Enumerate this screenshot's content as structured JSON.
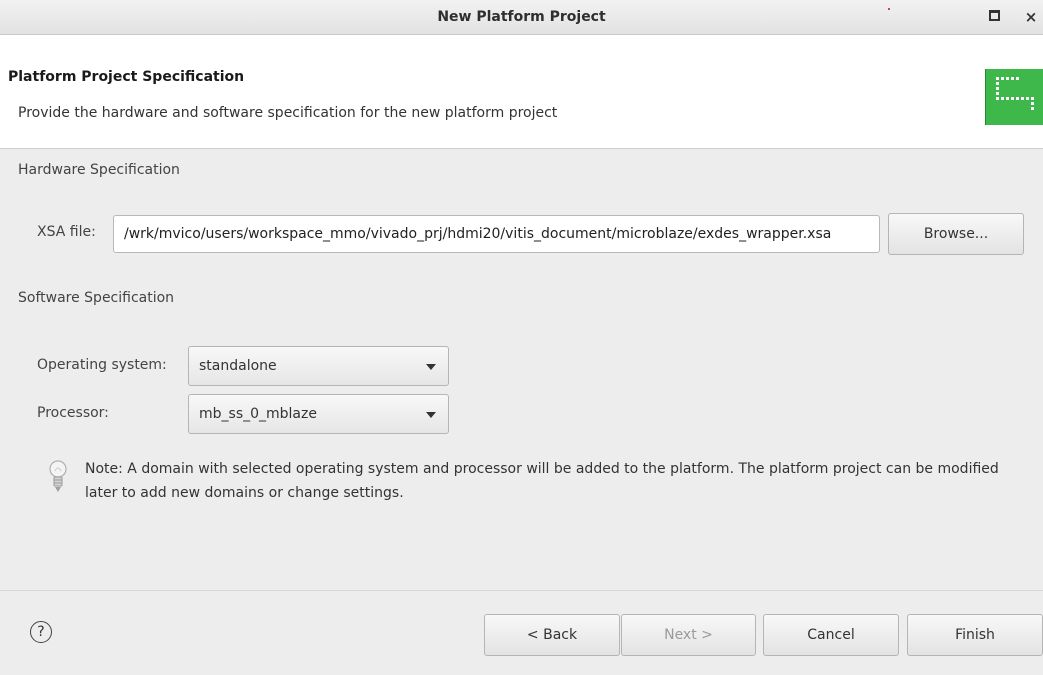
{
  "window": {
    "title": "New Platform Project",
    "maximize_icon": "maximize-icon",
    "close_icon": "close-icon",
    "close_glyph": "×"
  },
  "header": {
    "title": "Platform Project Specification",
    "description": "Provide the hardware and software specification for the new platform project",
    "banner_icon": "platform-wizard-banner-icon"
  },
  "hardware": {
    "section_label": "Hardware Specification",
    "xsa_label": "XSA file:",
    "xsa_value": "/wrk/mvico/users/workspace_mmo/vivado_prj/hdmi20/vitis_document/microblaze/exdes_wrapper.xsa",
    "browse_label": "Browse..."
  },
  "software": {
    "section_label": "Software Specification",
    "os_label": "Operating system:",
    "os_value": "standalone",
    "processor_label": "Processor:",
    "processor_value": "mb_ss_0_mblaze"
  },
  "note": {
    "text": "Note: A domain with selected operating system and processor will be added to the platform. The platform project can be modified later to add new domains or change settings.",
    "icon": "lightbulb-icon"
  },
  "footer": {
    "help_glyph": "?",
    "back_label": "< Back",
    "next_label": "Next >",
    "cancel_label": "Cancel",
    "finish_label": "Finish"
  },
  "colors": {
    "banner_green": "#3eb84a",
    "window_bg": "#ededed",
    "header_bg": "#ffffff"
  }
}
